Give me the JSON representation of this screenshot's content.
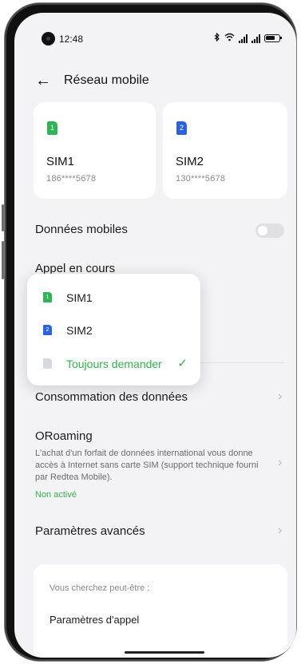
{
  "status_bar": {
    "time": "12:48",
    "icons": [
      "bluetooth-icon",
      "wifi-icon",
      "signal-icon",
      "signal-icon",
      "battery-icon"
    ]
  },
  "header": {
    "back_icon": "←",
    "title": "Réseau mobile"
  },
  "sim_cards": [
    {
      "chip": "1",
      "name": "SIM1",
      "number": "186****5678",
      "color": "#2fb553"
    },
    {
      "chip": "2",
      "name": "SIM2",
      "number": "130****5678",
      "color": "#2a62e5"
    }
  ],
  "settings": {
    "mobile_data_label": "Données mobiles",
    "mobile_data_enabled": false,
    "ongoing_call_label": "Appel en cours",
    "data_usage_label": "Consommation des données",
    "oroaming": {
      "title": "ORoaming",
      "description": "L'achat d'un forfait de données international vous donne accès à Internet sans carte SIM (support technique fourni par Redtea Mobile).",
      "status": "Non activé"
    },
    "advanced_label": "Paramètres avancés"
  },
  "popup_menu": {
    "items": [
      {
        "chip": "1",
        "label": "SIM1",
        "selected": false,
        "color": "#2fb553"
      },
      {
        "chip": "2",
        "label": "SIM2",
        "selected": false,
        "color": "#2a62e5"
      },
      {
        "chip": "",
        "label": "Toujours demander",
        "selected": true,
        "color": "#33b34c"
      }
    ],
    "check_icon": "✓"
  },
  "suggestions": {
    "hint": "Vous cherchez peut-être :",
    "link": "Paramètres d'appel"
  },
  "chevron": "›"
}
